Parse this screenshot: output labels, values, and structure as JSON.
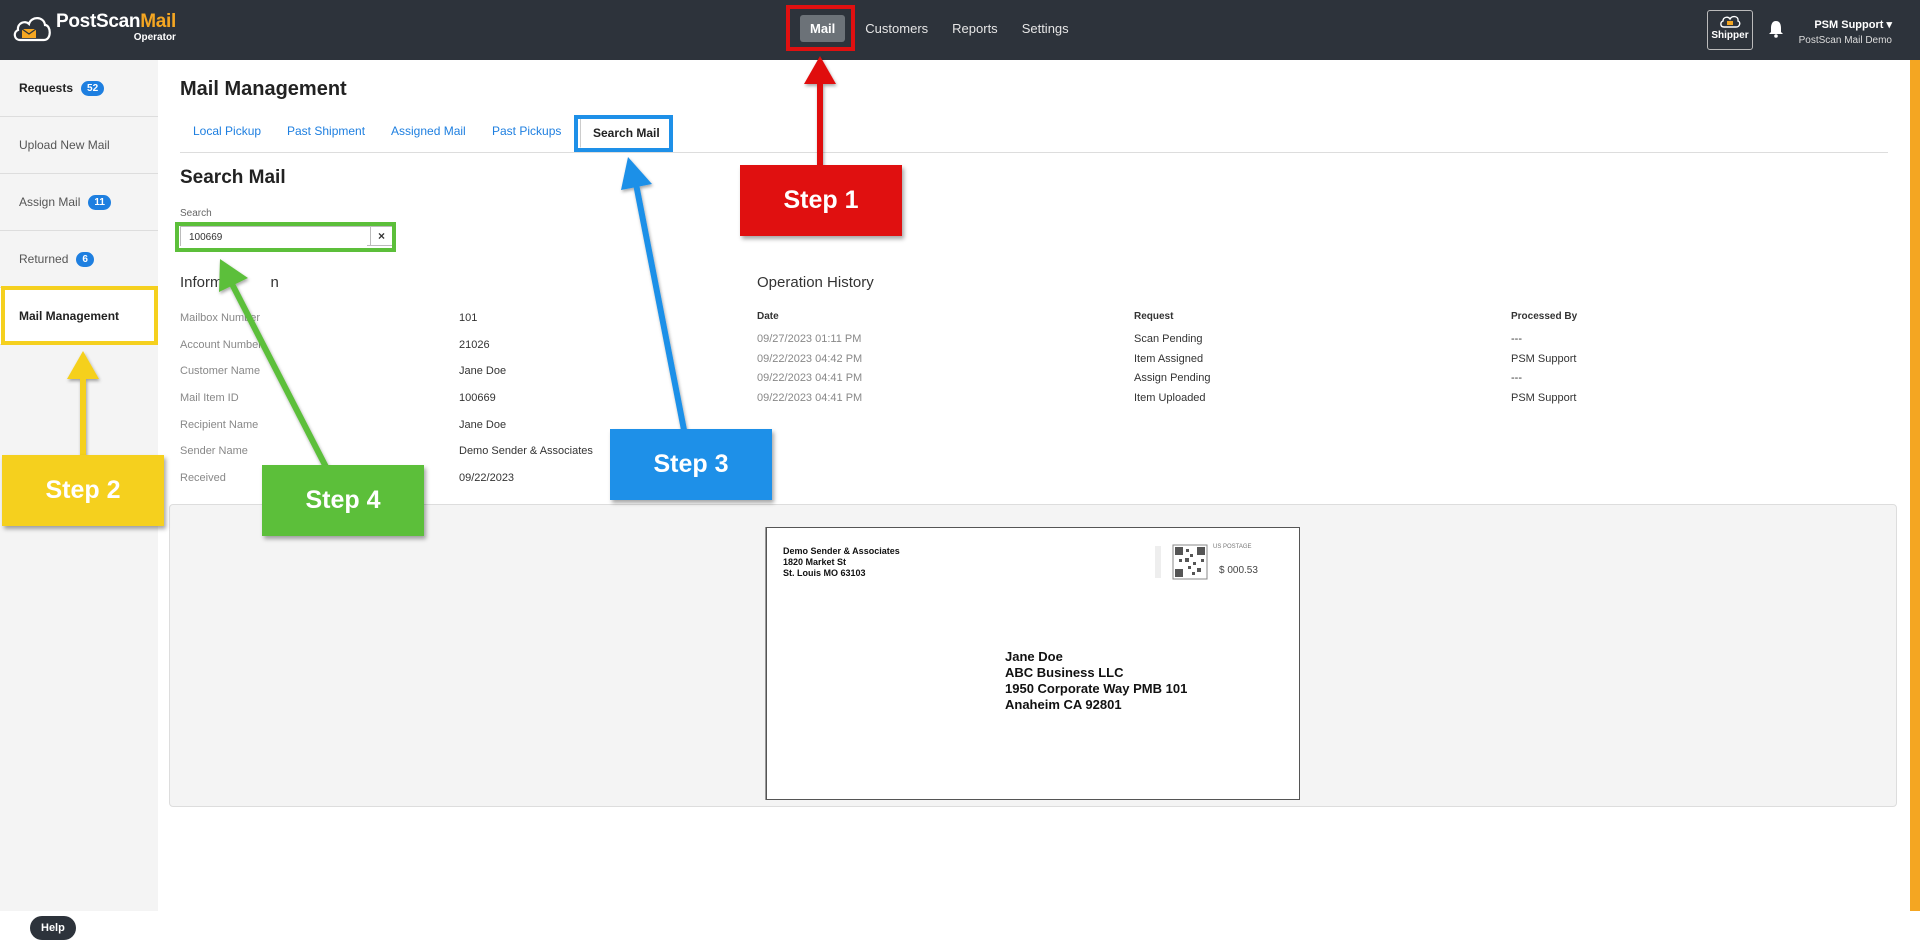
{
  "app": {
    "brand_prefix": "PostScan",
    "brand_accent": "Mail",
    "brand_sub": "Operator",
    "accent_color": "#f4a622",
    "topbar_color": "#2d333b",
    "link_color": "#1e7fe0"
  },
  "nav": {
    "items": [
      {
        "label": "Mail",
        "active": true
      },
      {
        "label": "Customers"
      },
      {
        "label": "Reports"
      },
      {
        "label": "Settings"
      }
    ]
  },
  "header": {
    "shipper_label": "Shipper",
    "user_name": "PSM Support",
    "user_org": "PostScan Mail Demo"
  },
  "sidebar": {
    "items": [
      {
        "label": "Requests",
        "badge": "52"
      },
      {
        "label": "Upload New Mail"
      },
      {
        "label": "Assign Mail",
        "badge": "11"
      },
      {
        "label": "Returned",
        "badge": "6"
      },
      {
        "label": "Mail Management",
        "active": true
      }
    ],
    "help_label": "Help"
  },
  "main": {
    "title": "Mail Management",
    "tabs": [
      {
        "label": "Local Pickup"
      },
      {
        "label": "Past Shipment"
      },
      {
        "label": "Assigned Mail"
      },
      {
        "label": "Past Pickups"
      },
      {
        "label": "Search Mail",
        "active": true
      }
    ],
    "section_title": "Search Mail",
    "search": {
      "label": "Search",
      "value": "100669",
      "clear_glyph": "×"
    }
  },
  "information": {
    "title_visible_start": "Inform",
    "title_visible_end": "n",
    "rows": [
      {
        "label": "Mailbox Number",
        "value": "101"
      },
      {
        "label": "Account Number",
        "value": "21026"
      },
      {
        "label": "Customer Name",
        "value": "Jane Doe"
      },
      {
        "label": "Mail Item ID",
        "value": "100669"
      },
      {
        "label": "Recipient Name",
        "value": "Jane Doe"
      },
      {
        "label": "Sender Name",
        "value": "Demo Sender & Associates"
      },
      {
        "label": "Received",
        "value": "09/22/2023"
      }
    ]
  },
  "history": {
    "title": "Operation History",
    "headers": {
      "date": "Date",
      "request": "Request",
      "processed_by": "Processed By"
    },
    "rows": [
      {
        "date": "09/27/2023 01:11 PM",
        "request": "Scan Pending",
        "processed_by": "---"
      },
      {
        "date": "09/22/2023 04:42 PM",
        "request": "Item Assigned",
        "processed_by": "PSM Support"
      },
      {
        "date": "09/22/2023 04:41 PM",
        "request": "Assign Pending",
        "processed_by": "---"
      },
      {
        "date": "09/22/2023 04:41 PM",
        "request": "Item Uploaded",
        "processed_by": "PSM Support"
      }
    ]
  },
  "envelope": {
    "sender_lines": [
      "Demo Sender & Associates",
      "1820 Market St",
      "St. Louis MO 63103"
    ],
    "recipient_lines": [
      "Jane Doe",
      "ABC Business LLC",
      "1950 Corporate Way PMB 101",
      "Anaheim CA 92801"
    ],
    "postage_label": "US POSTAGE",
    "postage_amount": "$ 000.53"
  },
  "steps": [
    {
      "label": "Step 1",
      "color": "#e01010"
    },
    {
      "label": "Step 2",
      "color": "#f5d01e"
    },
    {
      "label": "Step 3",
      "color": "#1e90e8"
    },
    {
      "label": "Step 4",
      "color": "#5cbf3a"
    }
  ]
}
